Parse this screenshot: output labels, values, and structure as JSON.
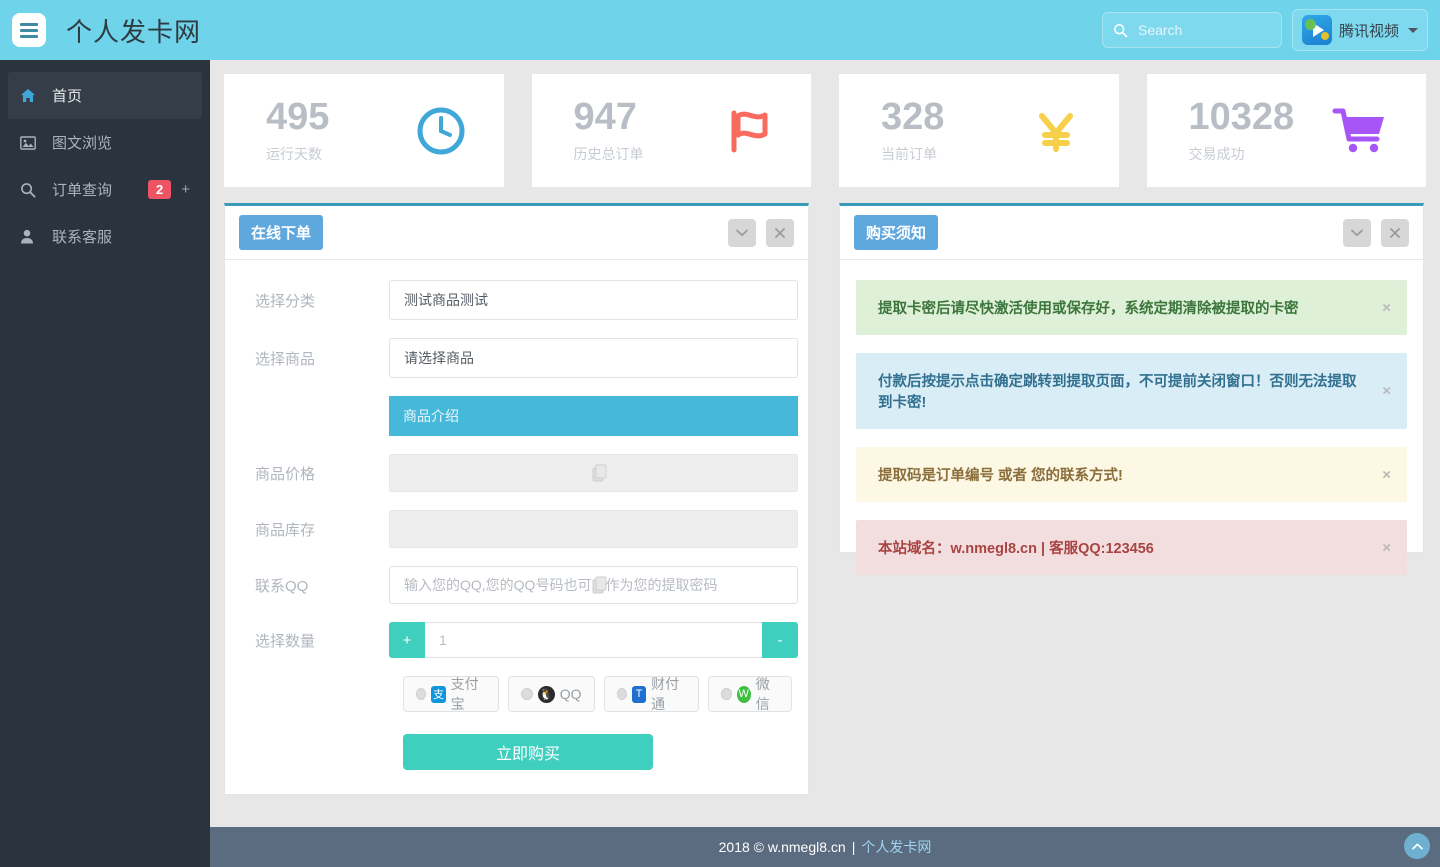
{
  "header": {
    "menu_icon": "hamburger-icon",
    "brand": "个人发卡网",
    "search": {
      "placeholder": "Search",
      "value": "",
      "icon": "search-icon"
    },
    "user": {
      "name": "腾讯视频",
      "logo_icon": "tencent-video-icon",
      "caret_icon": "chevron-down-icon"
    }
  },
  "sidebar": {
    "items": [
      {
        "label": "首页",
        "icon": "home-icon",
        "active": true
      },
      {
        "label": "图文浏览",
        "icon": "image-icon",
        "active": false
      },
      {
        "label": "订单查询",
        "icon": "search-icon",
        "active": false,
        "badge": "2",
        "expand": "+"
      },
      {
        "label": "联系客服",
        "icon": "user-icon",
        "active": false
      }
    ]
  },
  "stats": [
    {
      "value": "495",
      "label": "运行天数",
      "icon": "clock-icon",
      "color": "#40a8d8"
    },
    {
      "value": "947",
      "label": "历史总订单",
      "icon": "flag-icon",
      "color": "#f86b5e"
    },
    {
      "value": "328",
      "label": "当前订单",
      "icon": "yen-icon",
      "color": "#f7cf4a"
    },
    {
      "value": "10328",
      "label": "交易成功",
      "icon": "cart-icon",
      "color": "#a855f7"
    }
  ],
  "order_panel": {
    "title": "在线下单",
    "tools": {
      "collapse_icon": "chevron-down-icon",
      "close_icon": "close-icon"
    },
    "fields": {
      "category_label": "选择分类",
      "category_value": "测试商品测试",
      "product_label": "选择商品",
      "product_value": "请选择商品",
      "intro_text": "商品介绍",
      "price_label": "商品价格",
      "price_value": "",
      "stock_label": "商品库存",
      "stock_value": "",
      "qq_label": "联系QQ",
      "qq_placeholder": "输入您的QQ,您的QQ号码也可以作为您的提取密码",
      "quantity_label": "选择数量",
      "quantity_value": "1",
      "plus_label": "+",
      "minus_label": "-"
    },
    "payments": [
      {
        "label": "支付宝",
        "icon": "alipay-icon",
        "glyph": "支",
        "color": "#1296db"
      },
      {
        "label": "QQ",
        "icon": "qq-icon",
        "glyph": "Q",
        "color": "#f0a020"
      },
      {
        "label": "财付通",
        "icon": "tenpay-icon",
        "glyph": "T",
        "color": "#1f6fd0"
      },
      {
        "label": "微信",
        "icon": "wechat-icon",
        "glyph": "W",
        "color": "#3fbf3f"
      }
    ],
    "buy_button": "立即购买"
  },
  "notice_panel": {
    "title": "购买须知",
    "tools": {
      "collapse_icon": "chevron-down-icon",
      "close_icon": "close-icon"
    },
    "alerts": [
      {
        "type": "success",
        "text": "提取卡密后请尽快激活使用或保存好，系统定期清除被提取的卡密",
        "close": "×"
      },
      {
        "type": "info",
        "text": "付款后按提示点击确定跳转到提取页面，不可提前关闭窗口！否则无法提取到卡密!",
        "close": "×"
      },
      {
        "type": "warning",
        "text": "提取码是订单编号 或者 您的联系方式!",
        "close": "×"
      },
      {
        "type": "danger",
        "text": "本站域名：w.nmegl8.cn | 客服QQ:123456",
        "close": "×"
      }
    ]
  },
  "footer": {
    "copyright": "2018 © w.nmegl8.cn",
    "separator": "|",
    "site_link": "个人发卡网",
    "scroll_top_icon": "chevron-up-icon"
  }
}
